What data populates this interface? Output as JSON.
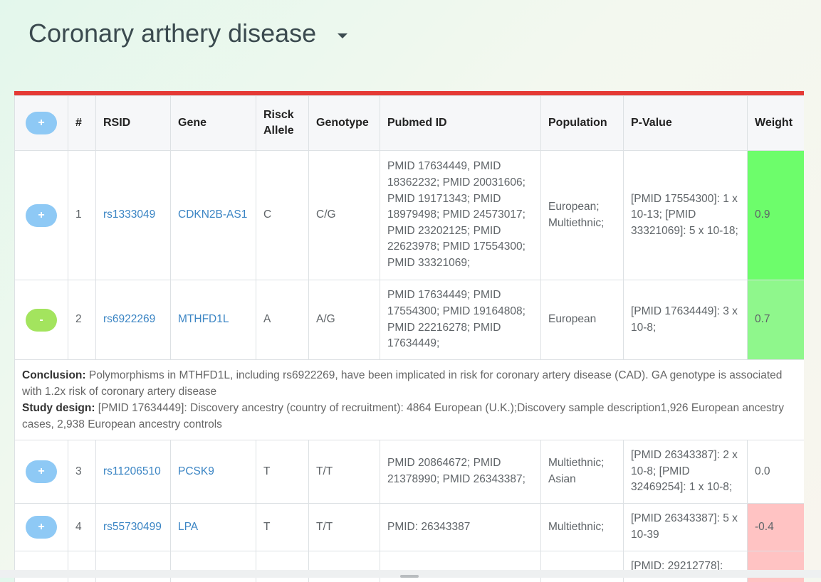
{
  "header": {
    "title": "Coronary arthery disease",
    "caret_icon": "caret-down-icon"
  },
  "colors": {
    "accent_bar": "#e53935",
    "expand_button": "#8ec9f5",
    "collapse_button": "#a3e45e",
    "weight_high": "#6dfd6b",
    "weight_mid": "#8ff78c",
    "weight_negative": "#ffc3c3"
  },
  "table": {
    "header_button": "+",
    "columns": [
      "#",
      "RSID",
      "Gene",
      "Risck Allele",
      "Genotype",
      "Pubmed ID",
      "Population",
      "P-Value",
      "Weight"
    ],
    "rows": [
      {
        "button": "+",
        "num": "1",
        "rsid": "rs1333049",
        "gene": "CDKN2B-AS1",
        "allele": "C",
        "genotype": "C/G",
        "pubmed": "PMID 17634449, PMID 18362232; PMID 20031606; PMID 19171343; PMID 18979498; PMID 24573017; PMID 23202125; PMID 22623978; PMID 17554300; PMID 33321069;",
        "population": "European; Multiethnic;",
        "pvalue": "[PMID 17554300]: 1 x 10-13; [PMID 33321069]: 5 x 10-18;",
        "weight": "0.9"
      },
      {
        "button": "-",
        "num": "2",
        "rsid": "rs6922269",
        "gene": "MTHFD1L",
        "allele": "A",
        "genotype": "A/G",
        "pubmed": "PMID 17634449; PMID 17554300; PMID 19164808; PMID 22216278; PMID 17634449;",
        "population": "European",
        "pvalue": "[PMID 17634449]: 3 x 10-8;",
        "weight": "0.7"
      },
      {
        "button": "+",
        "num": "3",
        "rsid": "rs11206510",
        "gene": "PCSK9",
        "allele": "T",
        "genotype": "T/T",
        "pubmed": "PMID 20864672; PMID 21378990; PMID 26343387;",
        "population": "Multiethnic; Asian",
        "pvalue": "[PMID 26343387]: 2 x 10-8; [PMID 32469254]: 1 x 10-8;",
        "weight": "0.0"
      },
      {
        "button": "+",
        "num": "4",
        "rsid": "rs55730499",
        "gene": "LPA",
        "allele": "T",
        "genotype": "T/T",
        "pubmed": "PMID: 26343387",
        "population": "Multiethnic;",
        "pvalue": "[PMID 26343387]: 5 x 10-39",
        "weight": "-0.4"
      },
      {
        "pvalue": "[PMID: 29212778]:"
      }
    ],
    "detail": {
      "conclusion_label": "Conclusion:",
      "conclusion_text": " Polymorphisms in MTHFD1L, including rs6922269, have been implicated in risk for coronary artery disease (CAD). GA genotype is associated with 1.2x risk of coronary artery disease",
      "design_label": "Study design:",
      "design_text": " [PMID 17634449]: Discovery ancestry (country of recruitment): 4864 European (U.K.);Discovery sample description1,926 European ancestry cases, 2,938 European ancestry controls"
    }
  }
}
